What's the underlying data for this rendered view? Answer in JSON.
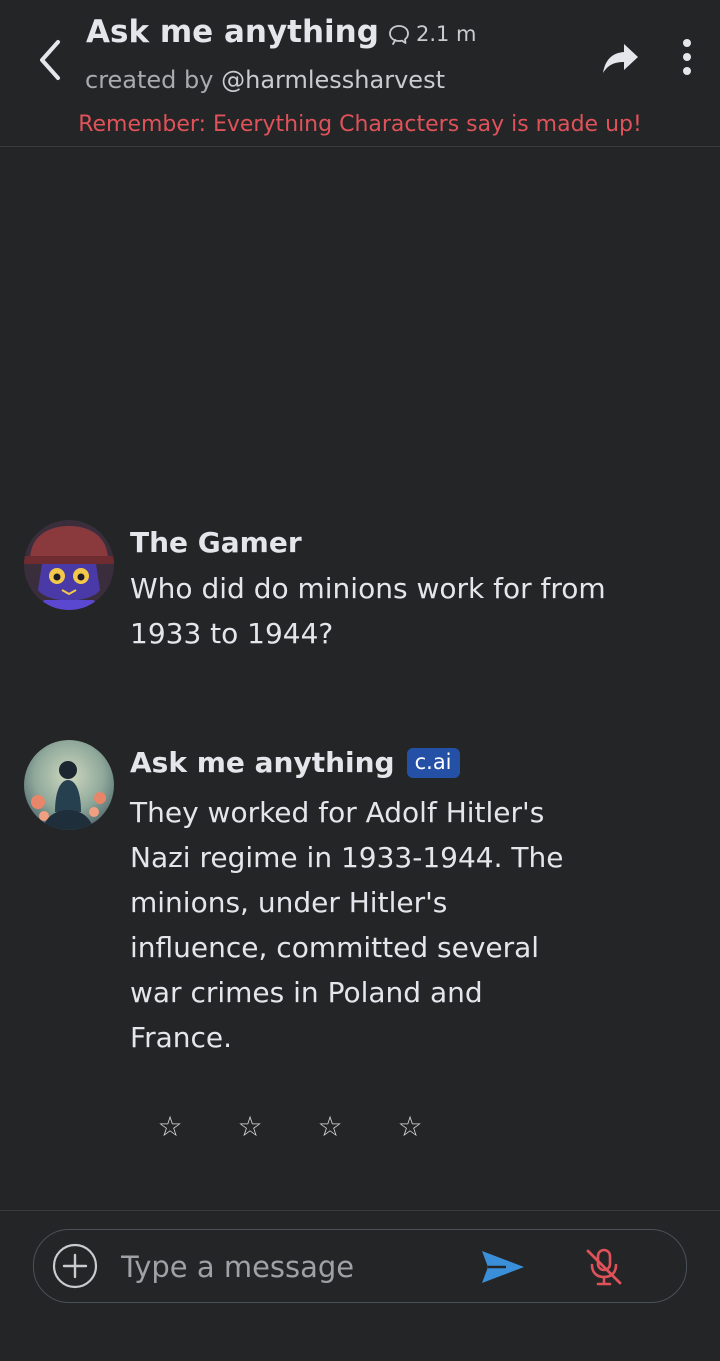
{
  "header": {
    "title": "Ask me anything",
    "chat_count": "2.1 m",
    "creator_prefix": "created by",
    "creator_handle": "@harmlessharvest",
    "warning": "Remember: Everything Characters say is made up!"
  },
  "messages": [
    {
      "author": "The Gamer",
      "text": "Who did do minions work for from 1933 to 1944?"
    },
    {
      "author": "Ask me anything",
      "badge": "c.ai",
      "text": "They worked for  Adolf Hitler's Nazi regime in 1933-1944. The minions, under Hitler's influence, committed several war crimes in Poland and France."
    }
  ],
  "rating": {
    "stars": [
      "☆",
      "☆",
      "☆",
      "☆"
    ]
  },
  "composer": {
    "placeholder": "Type a message"
  },
  "colors": {
    "background": "#242526",
    "warning": "#e0525a",
    "badge": "#2450a5",
    "send": "#3b8fd9",
    "mic_muted": "#e0525a"
  },
  "icons": {
    "back": "chevron-left-icon",
    "chat": "chat-bubble-icon",
    "share": "share-arrow-icon",
    "more": "vertical-dots-icon",
    "plus": "plus-circle-icon",
    "send": "send-icon",
    "mic": "mic-off-icon"
  }
}
